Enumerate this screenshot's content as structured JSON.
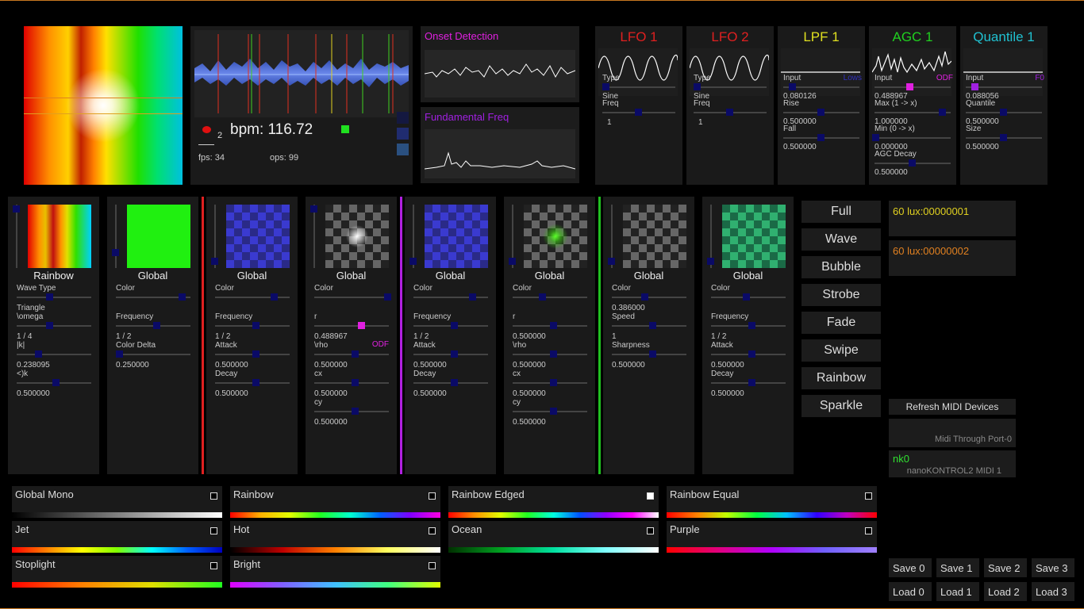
{
  "visualizer": {
    "bpm_label": "bpm: 116.72",
    "beat_index": "2",
    "fps_label": "fps: 34",
    "ops_label": "ops: 99"
  },
  "graphs": {
    "onset_title": "Onset Detection",
    "fund_title": "Fundamental Freq"
  },
  "modulators": [
    {
      "title": "LFO 1",
      "color": "#e02020",
      "rows": [
        {
          "label": "Type",
          "value": "Sine"
        },
        {
          "label": "Freq",
          "value": "1"
        }
      ]
    },
    {
      "title": "LFO 2",
      "color": "#e02020",
      "rows": [
        {
          "label": "Type",
          "value": "Sine"
        },
        {
          "label": "Freq",
          "value": "1"
        }
      ]
    },
    {
      "title": "LPF 1",
      "color": "#e0e020",
      "input_label": "Input",
      "input_source": "Lows",
      "source_color": "#3030c0",
      "rows": [
        {
          "label": "Rise",
          "value": "0.080126"
        },
        {
          "label": "Fall",
          "value": "0.500000"
        }
      ],
      "extra_value": "0.500000"
    },
    {
      "title": "AGC 1",
      "color": "#20d020",
      "input_label": "Input",
      "input_source": "ODF",
      "source_color": "#e020e0",
      "rows": [
        {
          "label": "Max (1 -> x)",
          "value": "0.488967"
        },
        {
          "label": "Min (0 -> x)",
          "value": "1.000000"
        },
        {
          "label": "AGC Decay",
          "value": "0.000000"
        }
      ],
      "extra_value": "0.500000"
    },
    {
      "title": "Quantile 1",
      "color": "#20c0d0",
      "input_label": "Input",
      "input_source": "F0",
      "source_color": "#a020e0",
      "rows": [
        {
          "label": "Quantile",
          "value": "0.088056"
        },
        {
          "label": "Size",
          "value": "0.500000"
        }
      ],
      "extra_value": "0.500000"
    }
  ],
  "patterns": [
    {
      "name": "Rainbow",
      "params": [
        {
          "label": "Wave Type",
          "value": "Triangle"
        },
        {
          "label": "\\omega",
          "value": "1 / 4"
        },
        {
          "label": "|k|",
          "value": "0.238095"
        },
        {
          "label": "<)k",
          "value": "0.500000"
        }
      ]
    },
    {
      "name": "Global",
      "params": [
        {
          "label": "Color",
          "value": ""
        },
        {
          "label": "Frequency",
          "value": "1 / 2"
        },
        {
          "label": "Color Delta",
          "value": "0.250000"
        }
      ]
    },
    {
      "name": "Global",
      "params": [
        {
          "label": "Color",
          "value": ""
        },
        {
          "label": "Frequency",
          "value": "1 / 2"
        },
        {
          "label": "Attack",
          "value": "0.500000"
        },
        {
          "label": "Decay",
          "value": "0.500000"
        }
      ]
    },
    {
      "name": "Global",
      "params": [
        {
          "label": "Color",
          "value": ""
        },
        {
          "label": "r",
          "value": "0.488967",
          "tag": "ODF"
        },
        {
          "label": "\\rho",
          "value": "0.500000"
        },
        {
          "label": "cx",
          "value": "0.500000"
        },
        {
          "label": "cy",
          "value": "0.500000"
        }
      ]
    },
    {
      "name": "Global",
      "params": [
        {
          "label": "Color",
          "value": ""
        },
        {
          "label": "Frequency",
          "value": "1 / 2"
        },
        {
          "label": "Attack",
          "value": "0.500000"
        },
        {
          "label": "Decay",
          "value": "0.500000"
        }
      ]
    },
    {
      "name": "Global",
      "params": [
        {
          "label": "Color",
          "value": ""
        },
        {
          "label": "r",
          "value": "0.500000"
        },
        {
          "label": "\\rho",
          "value": "0.500000"
        },
        {
          "label": "cx",
          "value": "0.500000"
        },
        {
          "label": "cy",
          "value": "0.500000"
        }
      ]
    },
    {
      "name": "Global",
      "params": [
        {
          "label": "Color",
          "value": "0.386000"
        },
        {
          "label": "Speed",
          "value": "1"
        },
        {
          "label": "Sharpness",
          "value": "0.500000"
        }
      ]
    },
    {
      "name": "Global",
      "params": [
        {
          "label": "Color",
          "value": ""
        },
        {
          "label": "Frequency",
          "value": "1 / 2"
        },
        {
          "label": "Attack",
          "value": "0.500000"
        },
        {
          "label": "Decay",
          "value": "0.500000"
        }
      ]
    }
  ],
  "pattern_buttons": [
    "Full",
    "Wave",
    "Bubble",
    "Strobe",
    "Fade",
    "Swipe",
    "Rainbow",
    "Sparkle"
  ],
  "outputs": [
    {
      "label": "60 lux:00000001",
      "color": "#e0d020"
    },
    {
      "label": "60 lux:00000002",
      "color": "#e08020"
    }
  ],
  "midi": {
    "refresh_label": "Refresh MIDI Devices",
    "device1": "Midi Through Port-0",
    "device2_short": "nk0",
    "device2": "nanoKONTROL2 MIDI 1"
  },
  "gradients": [
    {
      "name": "Global Mono",
      "checked": false
    },
    {
      "name": "Rainbow",
      "checked": false
    },
    {
      "name": "Rainbow Edged",
      "checked": true
    },
    {
      "name": "Rainbow Equal",
      "checked": false
    },
    {
      "name": "Jet",
      "checked": false
    },
    {
      "name": "Hot",
      "checked": false
    },
    {
      "name": "Ocean",
      "checked": false
    },
    {
      "name": "Purple",
      "checked": false
    },
    {
      "name": "Stoplight",
      "checked": false
    },
    {
      "name": "Bright",
      "checked": false
    }
  ],
  "state": {
    "save": [
      "Save 0",
      "Save 1",
      "Save 2",
      "Save 3"
    ],
    "load": [
      "Load 0",
      "Load 1",
      "Load 2",
      "Load 3"
    ]
  }
}
